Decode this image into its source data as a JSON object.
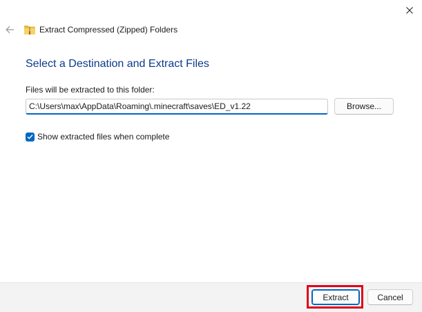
{
  "window": {
    "title": "Extract Compressed (Zipped) Folders",
    "close_icon": "close-icon",
    "back_icon": "back-arrow-icon",
    "folder_icon": "zipped-folder-icon"
  },
  "main": {
    "heading": "Select a Destination and Extract Files",
    "field_label": "Files will be extracted to this folder:",
    "path_value": "C:\\Users\\max\\AppData\\Roaming\\.minecraft\\saves\\ED_v1.22",
    "browse_label": "Browse...",
    "checkbox_label": "Show extracted files when complete",
    "checkbox_checked": true
  },
  "footer": {
    "extract_label": "Extract",
    "cancel_label": "Cancel"
  },
  "colors": {
    "heading": "#0b3a8c",
    "accent": "#0067c0",
    "highlight": "#e0001a"
  }
}
